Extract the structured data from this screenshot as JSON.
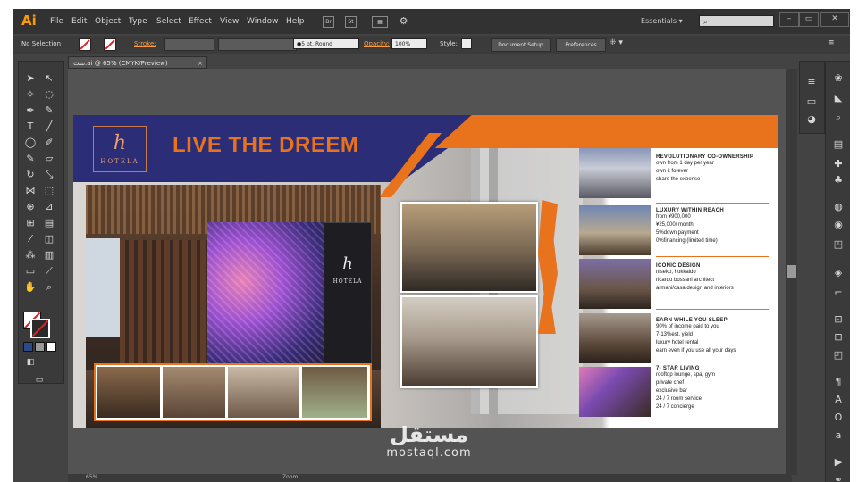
{
  "app": {
    "logo": "Ai"
  },
  "menu": [
    "File",
    "Edit",
    "Object",
    "Type",
    "Select",
    "Effect",
    "View",
    "Window",
    "Help"
  ],
  "menubar": {
    "icon_br": "Br",
    "icon_st": "St",
    "workspace": "Essentials",
    "search_icon": "search-icon"
  },
  "control": {
    "selection": "No Selection",
    "stroke_label": "Stroke:",
    "brush": "5 pt. Round",
    "opacity_label": "Opacity:",
    "opacity_value": "100%",
    "styles_label": "Style:",
    "doc_setup": "Document Setup",
    "preferences": "Preferences"
  },
  "document": {
    "tab_title": "تتتت.ai @ 65% (CMYK/Preview)",
    "zoom": "65%",
    "status": "Zoom"
  },
  "artwork": {
    "brand_mark": "h",
    "brand_name": "HOTELA",
    "headline": "LIVE THE DREEM",
    "features": [
      {
        "title": "REVOLUTIONARY CO-OWNERSHIP",
        "lines": [
          "own from 1 day per year",
          "own it forever",
          "share the expense"
        ]
      },
      {
        "title": "LUXURY WITHIN REACH",
        "lines": [
          "from ¥900,000",
          "¥25,000/ month",
          "5%down payment",
          "0%financing   (limited time)"
        ]
      },
      {
        "title": "ICONIC DESIGN",
        "lines": [
          "niseko, hokkaido",
          "ricardo bossani architect",
          "armani/casa design and interiors"
        ]
      },
      {
        "title": "EARN WHILE YOU SLEEP",
        "lines": [
          "90% of income paid to you",
          "7-13%est. yield",
          "luxury hotel rental",
          "earn even if you use all your days"
        ]
      },
      {
        "title": "7- STAR LIVING",
        "lines": [
          "rooftop lounge, spa, gym",
          "private chef",
          "exclusive bar",
          "24 / 7 room service",
          "24 / 7 concierge"
        ]
      }
    ]
  },
  "watermark": {
    "arabic": "مستقل",
    "latin": "mostaql.com"
  },
  "colors": {
    "navy": "#2b2d77",
    "orange": "#e9721d",
    "app_bg": "#434343"
  }
}
